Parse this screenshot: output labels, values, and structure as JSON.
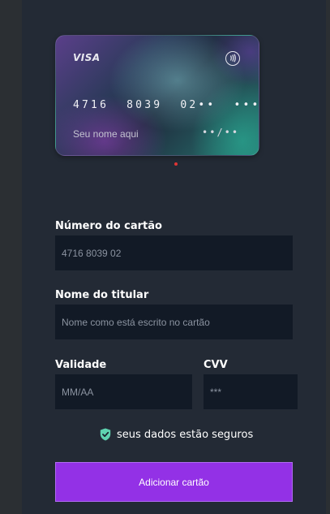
{
  "card": {
    "brand": "VISA",
    "number_display": "4716  8039  02••  ••••",
    "name_display": "Seu nome aqui",
    "expiry_display": "••/••"
  },
  "form": {
    "card_number_label": "Número do cartão",
    "card_number_value": "4716 8039 02",
    "holder_label": "Nome do titular",
    "holder_placeholder": "Nome como está escrito no cartão",
    "expiry_label": "Validade",
    "expiry_placeholder": "MM/AA",
    "cvv_label": "CVV",
    "cvv_placeholder": "***"
  },
  "security_note": "seus dados estão seguros",
  "submit_label": "Adicionar cartão",
  "colors": {
    "accent": "#9331e6",
    "shield": "#5fd3b0",
    "indicator": "#e03535"
  },
  "icons": {
    "contactless": "contactless-icon",
    "shield": "shield-check-icon"
  }
}
